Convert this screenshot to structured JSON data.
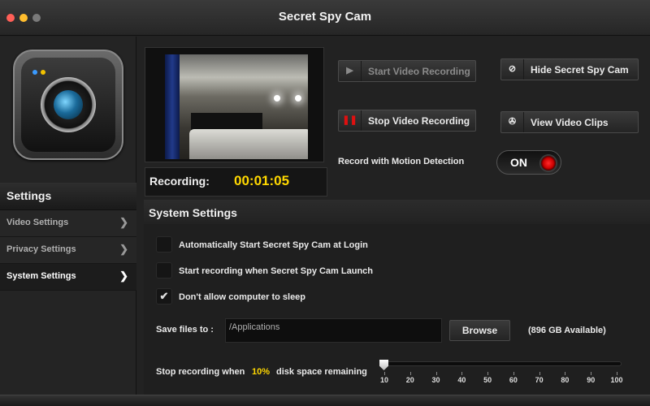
{
  "window": {
    "title": "Secret Spy Cam"
  },
  "sidebar": {
    "heading": "Settings",
    "items": [
      {
        "label": "Video Settings"
      },
      {
        "label": "Privacy Settings"
      },
      {
        "label": "System Settings"
      }
    ]
  },
  "recording": {
    "label": "Recording:",
    "time": "00:01:05"
  },
  "controls": {
    "start_label": "Start  Video Recording",
    "stop_label": "Stop Video  Recording",
    "hide_label": "Hide Secret Spy Cam",
    "clips_label": "View Video Clips",
    "motion_label": "Record with Motion Detection",
    "motion_toggle": "ON"
  },
  "system": {
    "heading": "System Settings",
    "options": [
      {
        "label": "Automatically Start Secret Spy Cam at Login",
        "checked": false
      },
      {
        "label": "Start recording when Secret Spy Cam Launch",
        "checked": false
      },
      {
        "label": "Don't allow computer to sleep",
        "checked": true
      }
    ],
    "save_label": "Save files to :",
    "save_path": "/Applications",
    "browse_label": "Browse",
    "available": "(896 GB Available)",
    "stop_prefix": "Stop recording when",
    "stop_percent": "10%",
    "stop_suffix": "disk space remaining",
    "slider_value": 10,
    "slider_ticks": [
      "10",
      "20",
      "30",
      "40",
      "50",
      "60",
      "70",
      "80",
      "90",
      "100"
    ]
  },
  "colors": {
    "accent": "#ffd800",
    "record": "#e01010"
  },
  "icons": {
    "start": "play-icon",
    "stop": "pause-icon",
    "hide": "forbidden-icon",
    "clips": "film-reel-icon"
  }
}
